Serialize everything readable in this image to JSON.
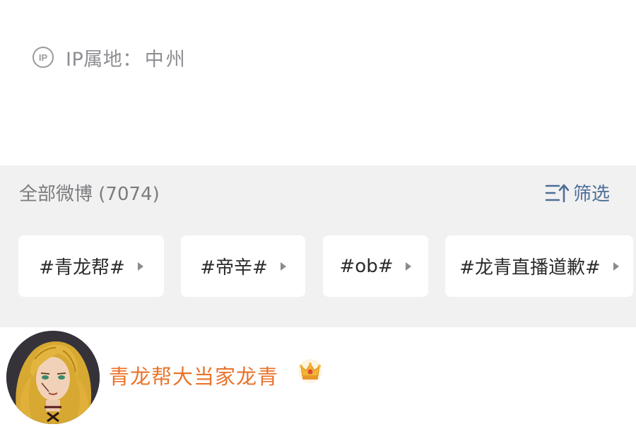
{
  "profile": {
    "ip_label": "IP属地：",
    "ip_value": "中州",
    "ip_icon_text": "IP"
  },
  "feed": {
    "title": "全部微博 (7074)",
    "filter_label": "筛选"
  },
  "tags": [
    {
      "label": "#青龙帮#"
    },
    {
      "label": "#帝辛#"
    },
    {
      "label": "#ob#"
    },
    {
      "label": "#龙青直播道歉#"
    }
  ],
  "post": {
    "author_name": "青龙帮大当家龙青",
    "badge_icon": "crown-icon"
  },
  "colors": {
    "band_bg": "#f1f1f1",
    "author_name": "#e8742c",
    "filter": "#4e6f99",
    "muted_text": "#8e8e93"
  }
}
